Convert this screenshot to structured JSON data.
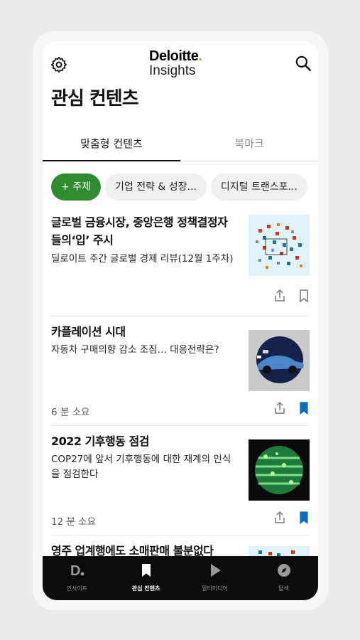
{
  "header": {
    "logo_line1": "Deloitte",
    "logo_dot": ".",
    "logo_line2": "Insights",
    "icons": {
      "settings": "gear-icon",
      "search": "search-icon"
    }
  },
  "page_title": "관심 컨텐츠",
  "tabs": [
    {
      "label": "맞춤형 컨텐츠",
      "active": true
    },
    {
      "label": "북마크",
      "active": false
    }
  ],
  "chips": [
    {
      "label": "+ 주제"
    },
    {
      "label": "기업 전략 & 성장..."
    },
    {
      "label": "디지털 트랜스포..."
    }
  ],
  "articles": [
    {
      "title": "글로벌 금융시장, 중앙은행 정책결정자들의‘입’ 주시",
      "subtitle": "딜로이트 주간 글로벌 경제 리뷰(12월 1주차)",
      "meta": "",
      "bookmarked": false
    },
    {
      "title": "카플레이션 시대",
      "subtitle": "자동차 구매의향 감소 조짐… 대응전략은?",
      "meta": "6 분 소요",
      "bookmarked": true
    },
    {
      "title": "2022 기후행동 점검",
      "subtitle": "COP27에 앞서 기후행동에 대한 재계의 인식을 점검한다",
      "meta": "12 분 소요",
      "bookmarked": true
    },
    {
      "title": "영주 업계행에도 소매판매 불분없다",
      "subtitle": "",
      "meta": "",
      "bookmarked": false
    }
  ],
  "bottom_nav": [
    {
      "label": "인사이트",
      "icon": "deloitte-d-icon",
      "active": false
    },
    {
      "label": "관심 컨텐츠",
      "icon": "bookmark-icon",
      "active": true
    },
    {
      "label": "멀티미디어",
      "icon": "play-icon",
      "active": false
    },
    {
      "label": "탐색",
      "icon": "compass-icon",
      "active": false
    }
  ],
  "colors": {
    "accent_green": "#86bc25",
    "chip_green": "#2e8b2e",
    "bookmark_blue": "#0a6ebd",
    "nav_bg": "#0c0c0c"
  }
}
